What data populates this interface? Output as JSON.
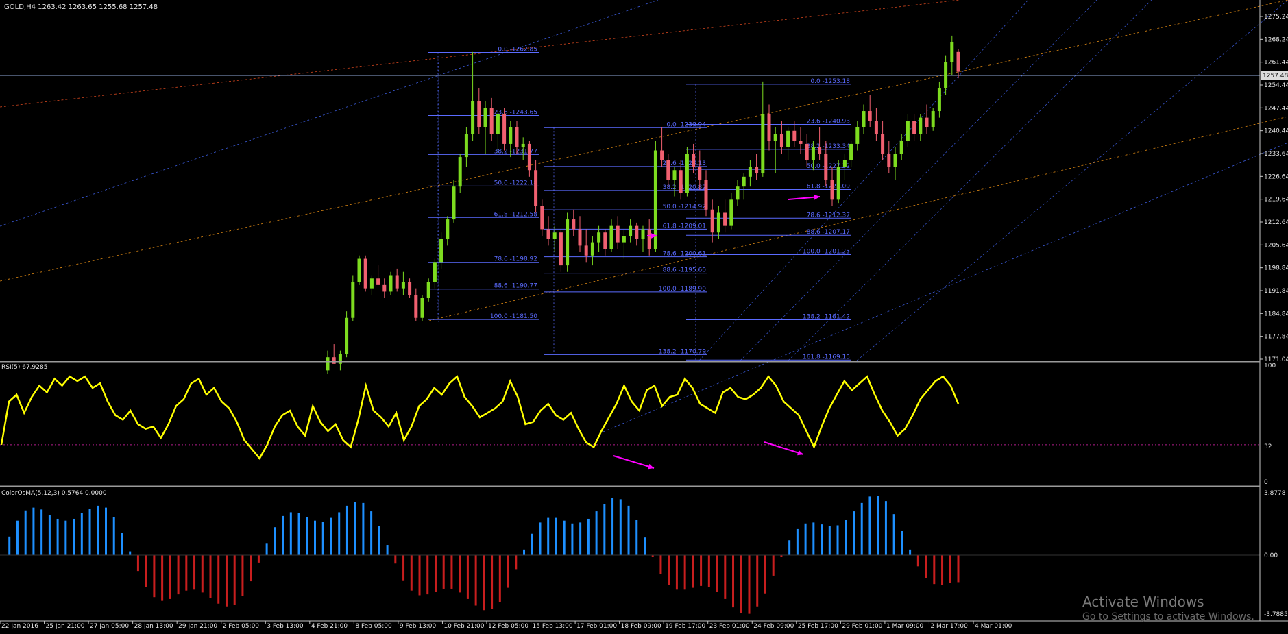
{
  "symbol_header": {
    "symbol": "GOLD,H4",
    "ohlc": "1263.42 1263.65 1255.68 1257.48"
  },
  "colors": {
    "background": "#000000",
    "axis": "#c8c8c8",
    "bull_candle": "#7ddc1f",
    "bear_candle": "#f06070",
    "fib": "#5b6bff",
    "rsi_line": "#ffff00",
    "rsi_level": "#b41e8c",
    "osma_pos": "#1e90ff",
    "osma_neg": "#c81e1e",
    "arrow": "#ff00ff",
    "trend_blue": "#3b5bdb",
    "trend_orange": "#e08a14",
    "trend_red": "#d2461e",
    "current_price_line": "#8fa8d8"
  },
  "price_axis": {
    "labels": [
      "1275.24",
      "1268.24",
      "1261.44",
      "1254.44",
      "1247.44",
      "1240.44",
      "1233.64",
      "1226.64",
      "1219.64",
      "1212.64",
      "1205.64",
      "1198.84",
      "1191.84",
      "1184.84",
      "1177.84",
      "1171.04"
    ],
    "current_price_label": "1257.48"
  },
  "rsi_panel": {
    "title": "RSI(5) 67.9285",
    "levels": [
      "100",
      "32",
      "0"
    ]
  },
  "osma_panel": {
    "title": "ColorOsMA(5,12,3) 0.5764 0.0000",
    "levels": [
      "3.8778",
      "0.00",
      "-3.7885"
    ]
  },
  "time_axis": [
    "22 Jan 2016",
    "25 Jan 21:00",
    "27 Jan 05:00",
    "28 Jan 13:00",
    "29 Jan 21:00",
    "2 Feb 05:00",
    "3 Feb 13:00",
    "4 Feb 21:00",
    "8 Feb 05:00",
    "9 Feb 13:00",
    "10 Feb 21:00",
    "12 Feb 05:00",
    "15 Feb 13:00",
    "17 Feb 01:00",
    "18 Feb 09:00",
    "19 Feb 17:00",
    "23 Feb 01:00",
    "24 Feb 09:00",
    "25 Feb 17:00",
    "29 Feb 01:00",
    "1 Mar 09:00",
    "2 Mar 17:00",
    "4 Mar 01:00"
  ],
  "fib_sets": [
    {
      "levels": [
        "0.0 -1262.85",
        "23.6 -1243.65",
        "38.2 -1231.77",
        "50.0 -1222.18",
        "61.8 -1212.58",
        "78.6 -1198.92",
        "88.6 -1190.77",
        "100.0 -1181.50"
      ]
    },
    {
      "levels": [
        "0.0 -1239.94",
        "23.6 -1228.13",
        "38.2 -1220.82",
        "50.0 -1214.92",
        "61.8 -1209.01",
        "78.6 -1200.61",
        "88.6 -1195.60",
        "100.0 -1189.90",
        "138.2 -1170.79"
      ]
    },
    {
      "levels": [
        "0.0 -1253.18",
        "23.6 -1240.93",
        "38.2 -1233.34",
        "50.0 -1227.22",
        "61.8 -1221.09",
        "78.6 -1212.37",
        "88.6 -1207.17",
        "100.0 -1201.25",
        "138.2 -1181.42",
        "161.8 -1169.15"
      ]
    }
  ],
  "watermark": {
    "line1": "Activate Windows",
    "line2": "Go to Settings to activate Windows."
  },
  "chart_data": {
    "type": "candlestick",
    "title": "GOLD,H4",
    "ylim": [
      1169.0,
      1278.0
    ],
    "candles": [
      [
        1166,
        1172,
        1165,
        1170
      ],
      [
        1170,
        1174,
        1168,
        1168
      ],
      [
        1168,
        1172,
        1166,
        1171
      ],
      [
        1171,
        1184,
        1170,
        1182
      ],
      [
        1182,
        1195,
        1181,
        1193
      ],
      [
        1193,
        1201,
        1192,
        1200
      ],
      [
        1200,
        1201,
        1190,
        1191
      ],
      [
        1191,
        1195,
        1189,
        1194
      ],
      [
        1194,
        1198,
        1192,
        1192
      ],
      [
        1192,
        1194,
        1188,
        1190
      ],
      [
        1190,
        1196,
        1189,
        1195
      ],
      [
        1195,
        1197,
        1190,
        1191
      ],
      [
        1191,
        1196,
        1189,
        1193
      ],
      [
        1193,
        1194,
        1188,
        1189
      ],
      [
        1189,
        1191,
        1181,
        1182
      ],
      [
        1182,
        1189,
        1181,
        1188
      ],
      [
        1188,
        1194,
        1187,
        1193
      ],
      [
        1193,
        1200,
        1191,
        1199
      ],
      [
        1199,
        1208,
        1197,
        1206
      ],
      [
        1206,
        1213,
        1204,
        1212
      ],
      [
        1212,
        1224,
        1211,
        1222
      ],
      [
        1222,
        1232,
        1220,
        1231
      ],
      [
        1231,
        1240,
        1228,
        1238
      ],
      [
        1238,
        1263,
        1236,
        1248
      ],
      [
        1248,
        1252,
        1238,
        1240
      ],
      [
        1240,
        1248,
        1232,
        1246
      ],
      [
        1246,
        1249,
        1236,
        1238
      ],
      [
        1238,
        1245,
        1232,
        1244
      ],
      [
        1244,
        1246,
        1233,
        1235
      ],
      [
        1235,
        1242,
        1231,
        1240
      ],
      [
        1240,
        1242,
        1232,
        1234
      ],
      [
        1234,
        1237,
        1230,
        1235
      ],
      [
        1235,
        1236,
        1225,
        1227
      ],
      [
        1227,
        1230,
        1214,
        1216
      ],
      [
        1216,
        1218,
        1207,
        1209
      ],
      [
        1209,
        1213,
        1204,
        1206
      ],
      [
        1206,
        1210,
        1202,
        1208
      ],
      [
        1208,
        1209,
        1196,
        1198
      ],
      [
        1198,
        1214,
        1196,
        1212
      ],
      [
        1212,
        1215,
        1207,
        1209
      ],
      [
        1209,
        1213,
        1202,
        1204
      ],
      [
        1204,
        1209,
        1199,
        1201
      ],
      [
        1201,
        1207,
        1198,
        1205
      ],
      [
        1205,
        1210,
        1202,
        1208
      ],
      [
        1208,
        1209,
        1201,
        1203
      ],
      [
        1203,
        1212,
        1202,
        1210
      ],
      [
        1210,
        1213,
        1203,
        1205
      ],
      [
        1205,
        1209,
        1200,
        1207
      ],
      [
        1207,
        1212,
        1205,
        1210
      ],
      [
        1210,
        1211,
        1204,
        1206
      ],
      [
        1206,
        1210,
        1202,
        1209
      ],
      [
        1209,
        1212,
        1201,
        1203
      ],
      [
        1203,
        1236,
        1202,
        1233
      ],
      [
        1233,
        1240,
        1228,
        1230
      ],
      [
        1230,
        1232,
        1222,
        1224
      ],
      [
        1224,
        1228,
        1219,
        1227
      ],
      [
        1227,
        1230,
        1218,
        1220
      ],
      [
        1220,
        1234,
        1219,
        1232
      ],
      [
        1232,
        1235,
        1226,
        1228
      ],
      [
        1228,
        1233,
        1221,
        1224
      ],
      [
        1224,
        1227,
        1213,
        1215
      ],
      [
        1215,
        1218,
        1205,
        1208
      ],
      [
        1208,
        1216,
        1206,
        1214
      ],
      [
        1214,
        1218,
        1208,
        1210
      ],
      [
        1210,
        1220,
        1209,
        1218
      ],
      [
        1218,
        1224,
        1216,
        1222
      ],
      [
        1222,
        1226,
        1218,
        1225
      ],
      [
        1225,
        1230,
        1222,
        1228
      ],
      [
        1228,
        1232,
        1224,
        1226
      ],
      [
        1226,
        1254,
        1225,
        1244
      ],
      [
        1244,
        1247,
        1233,
        1236
      ],
      [
        1236,
        1240,
        1226,
        1238
      ],
      [
        1238,
        1242,
        1232,
        1234
      ],
      [
        1234,
        1240,
        1230,
        1239
      ],
      [
        1239,
        1242,
        1234,
        1236
      ],
      [
        1236,
        1240,
        1232,
        1235
      ],
      [
        1235,
        1238,
        1228,
        1230
      ],
      [
        1230,
        1236,
        1227,
        1234
      ],
      [
        1234,
        1240,
        1230,
        1232
      ],
      [
        1232,
        1236,
        1222,
        1224
      ],
      [
        1224,
        1228,
        1216,
        1218
      ],
      [
        1218,
        1230,
        1217,
        1228
      ],
      [
        1228,
        1232,
        1224,
        1230
      ],
      [
        1230,
        1236,
        1228,
        1235
      ],
      [
        1235,
        1242,
        1233,
        1240
      ],
      [
        1240,
        1247,
        1238,
        1245
      ],
      [
        1245,
        1250,
        1240,
        1242
      ],
      [
        1242,
        1246,
        1236,
        1238
      ],
      [
        1238,
        1242,
        1230,
        1232
      ],
      [
        1232,
        1236,
        1226,
        1228
      ],
      [
        1228,
        1234,
        1224,
        1232
      ],
      [
        1232,
        1238,
        1230,
        1236
      ],
      [
        1236,
        1244,
        1234,
        1242
      ],
      [
        1242,
        1244,
        1236,
        1238
      ],
      [
        1238,
        1244,
        1236,
        1243
      ],
      [
        1243,
        1247,
        1238,
        1240
      ],
      [
        1240,
        1246,
        1239,
        1245
      ],
      [
        1245,
        1254,
        1243,
        1252
      ],
      [
        1252,
        1262,
        1250,
        1260
      ],
      [
        1260,
        1268,
        1256,
        1266
      ],
      [
        1263,
        1264,
        1255,
        1257
      ]
    ],
    "rsi": [
      32,
      70,
      76,
      60,
      74,
      84,
      78,
      90,
      84,
      92,
      88,
      92,
      82,
      86,
      70,
      58,
      54,
      62,
      50,
      46,
      48,
      38,
      50,
      66,
      72,
      86,
      90,
      76,
      82,
      70,
      64,
      52,
      36,
      28,
      20,
      32,
      48,
      58,
      62,
      48,
      40,
      66,
      52,
      44,
      50,
      36,
      30,
      54,
      84,
      62,
      56,
      48,
      60,
      36,
      48,
      66,
      72,
      82,
      76,
      86,
      92,
      74,
      66,
      56,
      60,
      64,
      70,
      88,
      74,
      50,
      52,
      62,
      68,
      58,
      54,
      60,
      46,
      34,
      30,
      44,
      56,
      68,
      84,
      70,
      62,
      80,
      84,
      66,
      74,
      76,
      90,
      82,
      68,
      64,
      60,
      78,
      82,
      74,
      72,
      76,
      82,
      92,
      84,
      70,
      64,
      58,
      44,
      30,
      48,
      64,
      76,
      88,
      80,
      86,
      92,
      76,
      62,
      52,
      40,
      46,
      58,
      72,
      80,
      88,
      92,
      84,
      68
    ]
  }
}
